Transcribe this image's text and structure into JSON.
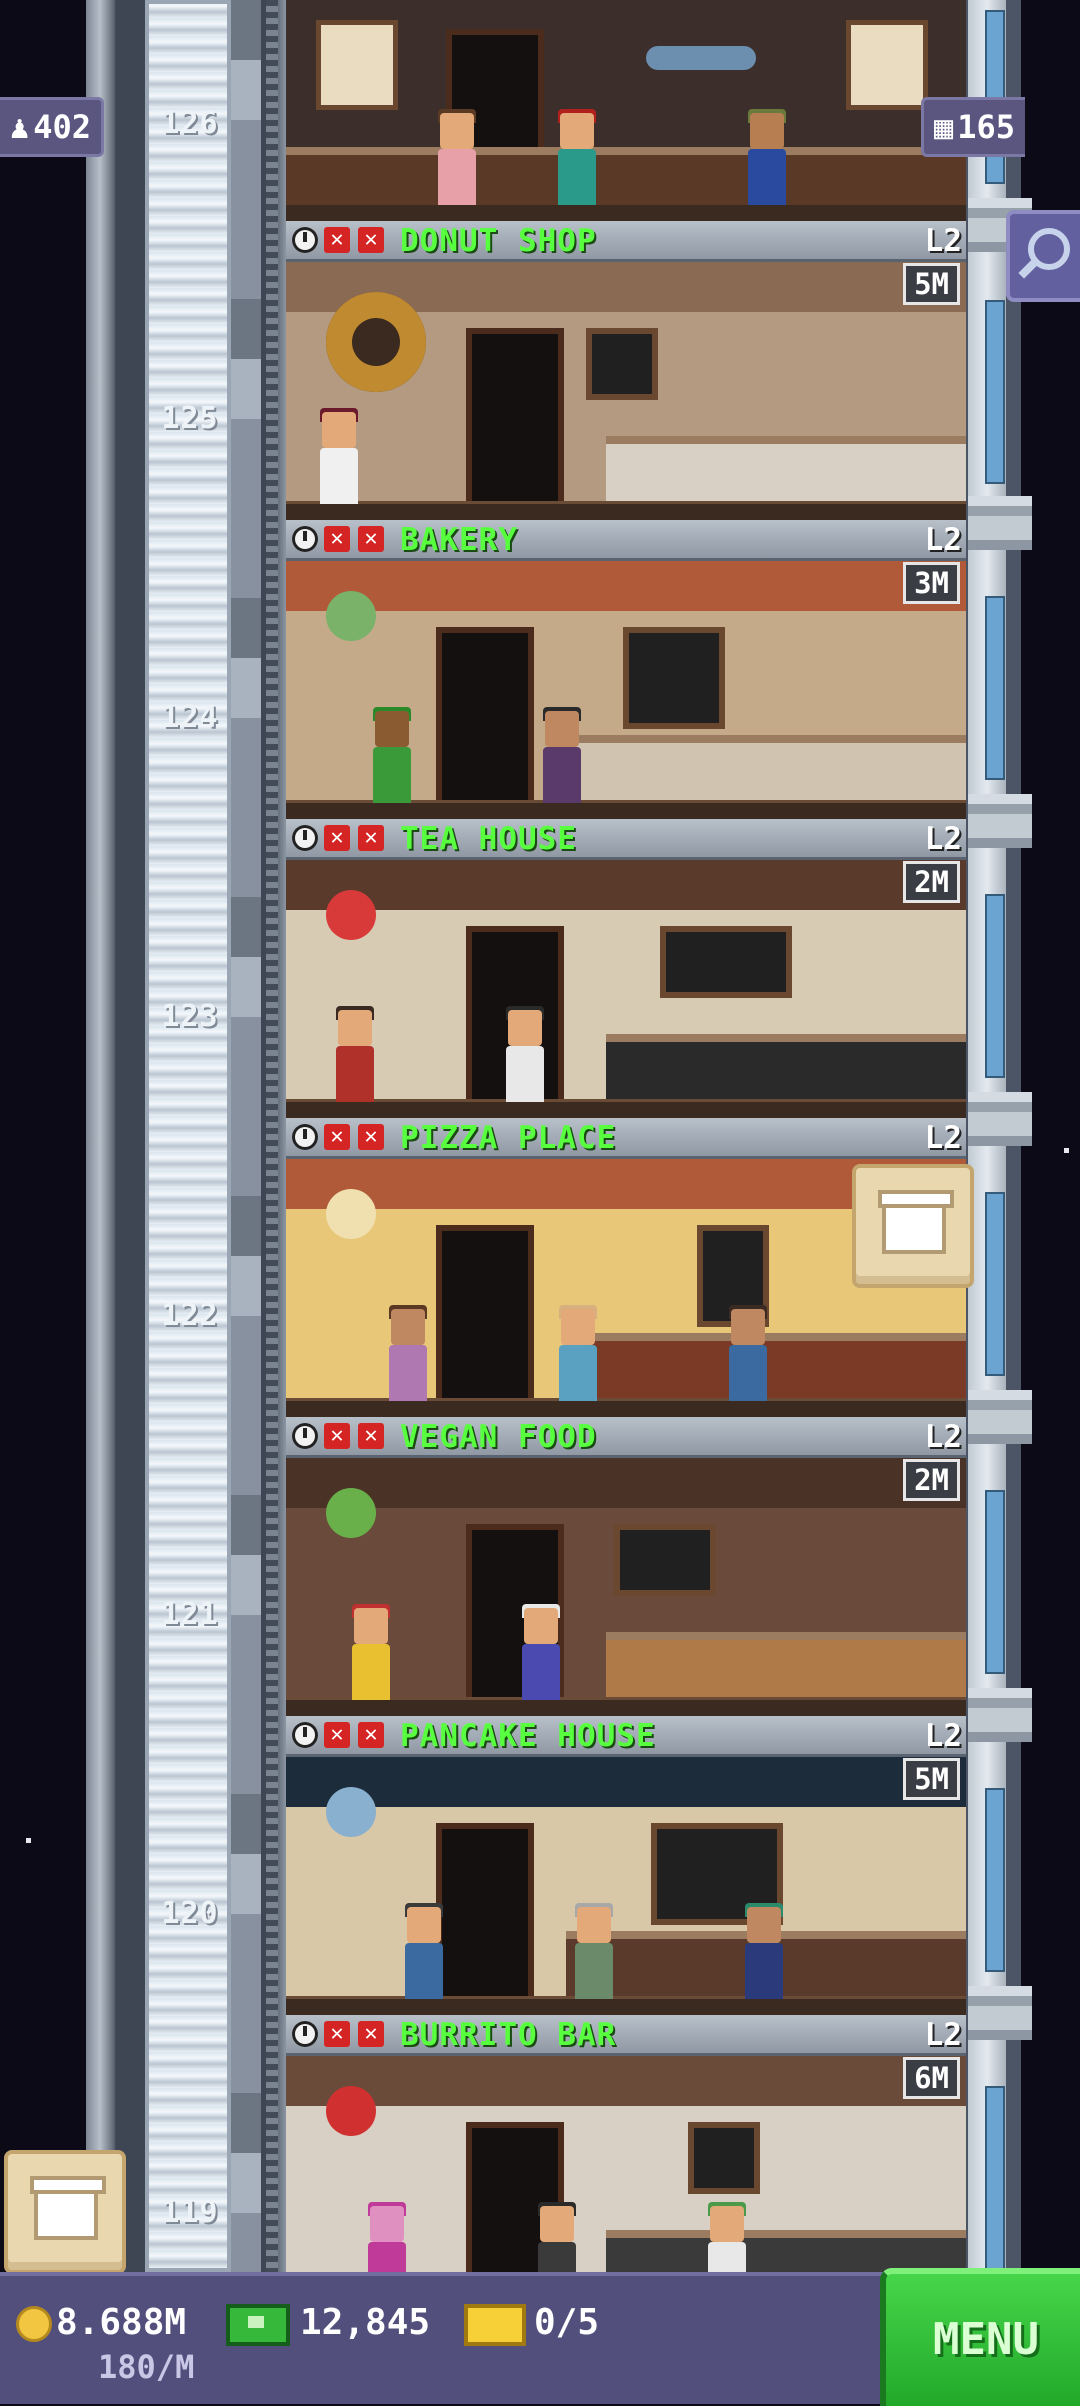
{
  "hud_top": {
    "population": "402",
    "floors": "165"
  },
  "floors_partial_top": {
    "number": "126"
  },
  "floors": [
    {
      "number": "125",
      "name": "DONUT SHOP",
      "level": "L2",
      "stock": "5M"
    },
    {
      "number": "124",
      "name": "BAKERY",
      "level": "L2",
      "stock": "3M"
    },
    {
      "number": "123",
      "name": "TEA HOUSE",
      "level": "L2",
      "stock": "2M"
    },
    {
      "number": "122",
      "name": "PIZZA PLACE",
      "level": "L2",
      "stock": ""
    },
    {
      "number": "121",
      "name": "VEGAN FOOD",
      "level": "L2",
      "stock": "2M"
    },
    {
      "number": "120",
      "name": "PANCAKE HOUSE",
      "level": "L2",
      "stock": "5M"
    },
    {
      "number": "119",
      "name": "BURRITO BAR",
      "level": "L2",
      "stock": "6M"
    }
  ],
  "hud_bottom": {
    "coins": "8.688M",
    "tower_bux": "12,845",
    "tickets": "0/5",
    "income_rate": "180/M",
    "menu_label": "MENU"
  },
  "colors": {
    "floor_name": "#57ff3e",
    "hud_bg": "#534f7c",
    "menu_green": "#2fbe34"
  },
  "icons": [
    "population-icon",
    "floors-icon",
    "search-icon",
    "delivery-box-icon",
    "clock-icon",
    "x-icon",
    "coin-icon",
    "bux-icon",
    "ticket-icon"
  ]
}
